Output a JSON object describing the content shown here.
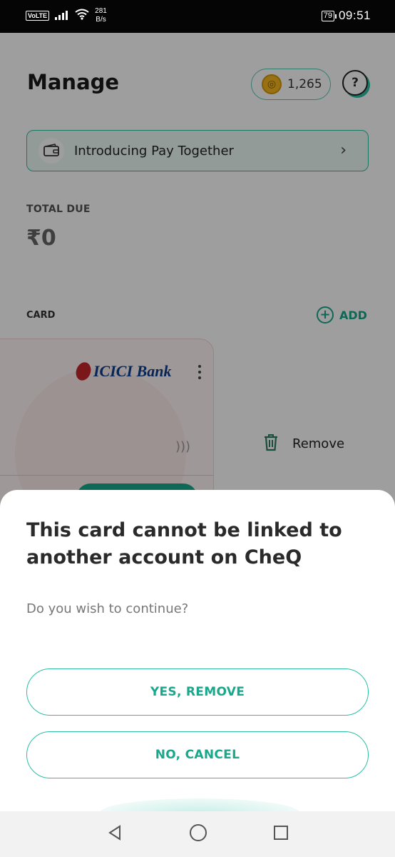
{
  "status_bar": {
    "volte": "VoLTE",
    "net_speed_value": "281",
    "net_speed_unit": "B/s",
    "battery": "79",
    "time": "09:51"
  },
  "header": {
    "title": "Manage",
    "coins": "1,265",
    "help_label": "?"
  },
  "banner": {
    "text": "Introducing Pay Together"
  },
  "total_due": {
    "label": "TOTAL DUE",
    "value": "₹0"
  },
  "card_section": {
    "label": "CARD",
    "add_label": "ADD",
    "bank_name": "ICICI Bank",
    "remove_label": "Remove"
  },
  "dialog": {
    "title": "This card cannot be linked to another account on CheQ",
    "subtitle": "Do you wish to continue?",
    "confirm_label": "YES, REMOVE",
    "cancel_label": "NO, CANCEL"
  },
  "colors": {
    "accent": "#18a88c",
    "accent_border": "#2bbfa3",
    "status_bar": "#050505"
  }
}
